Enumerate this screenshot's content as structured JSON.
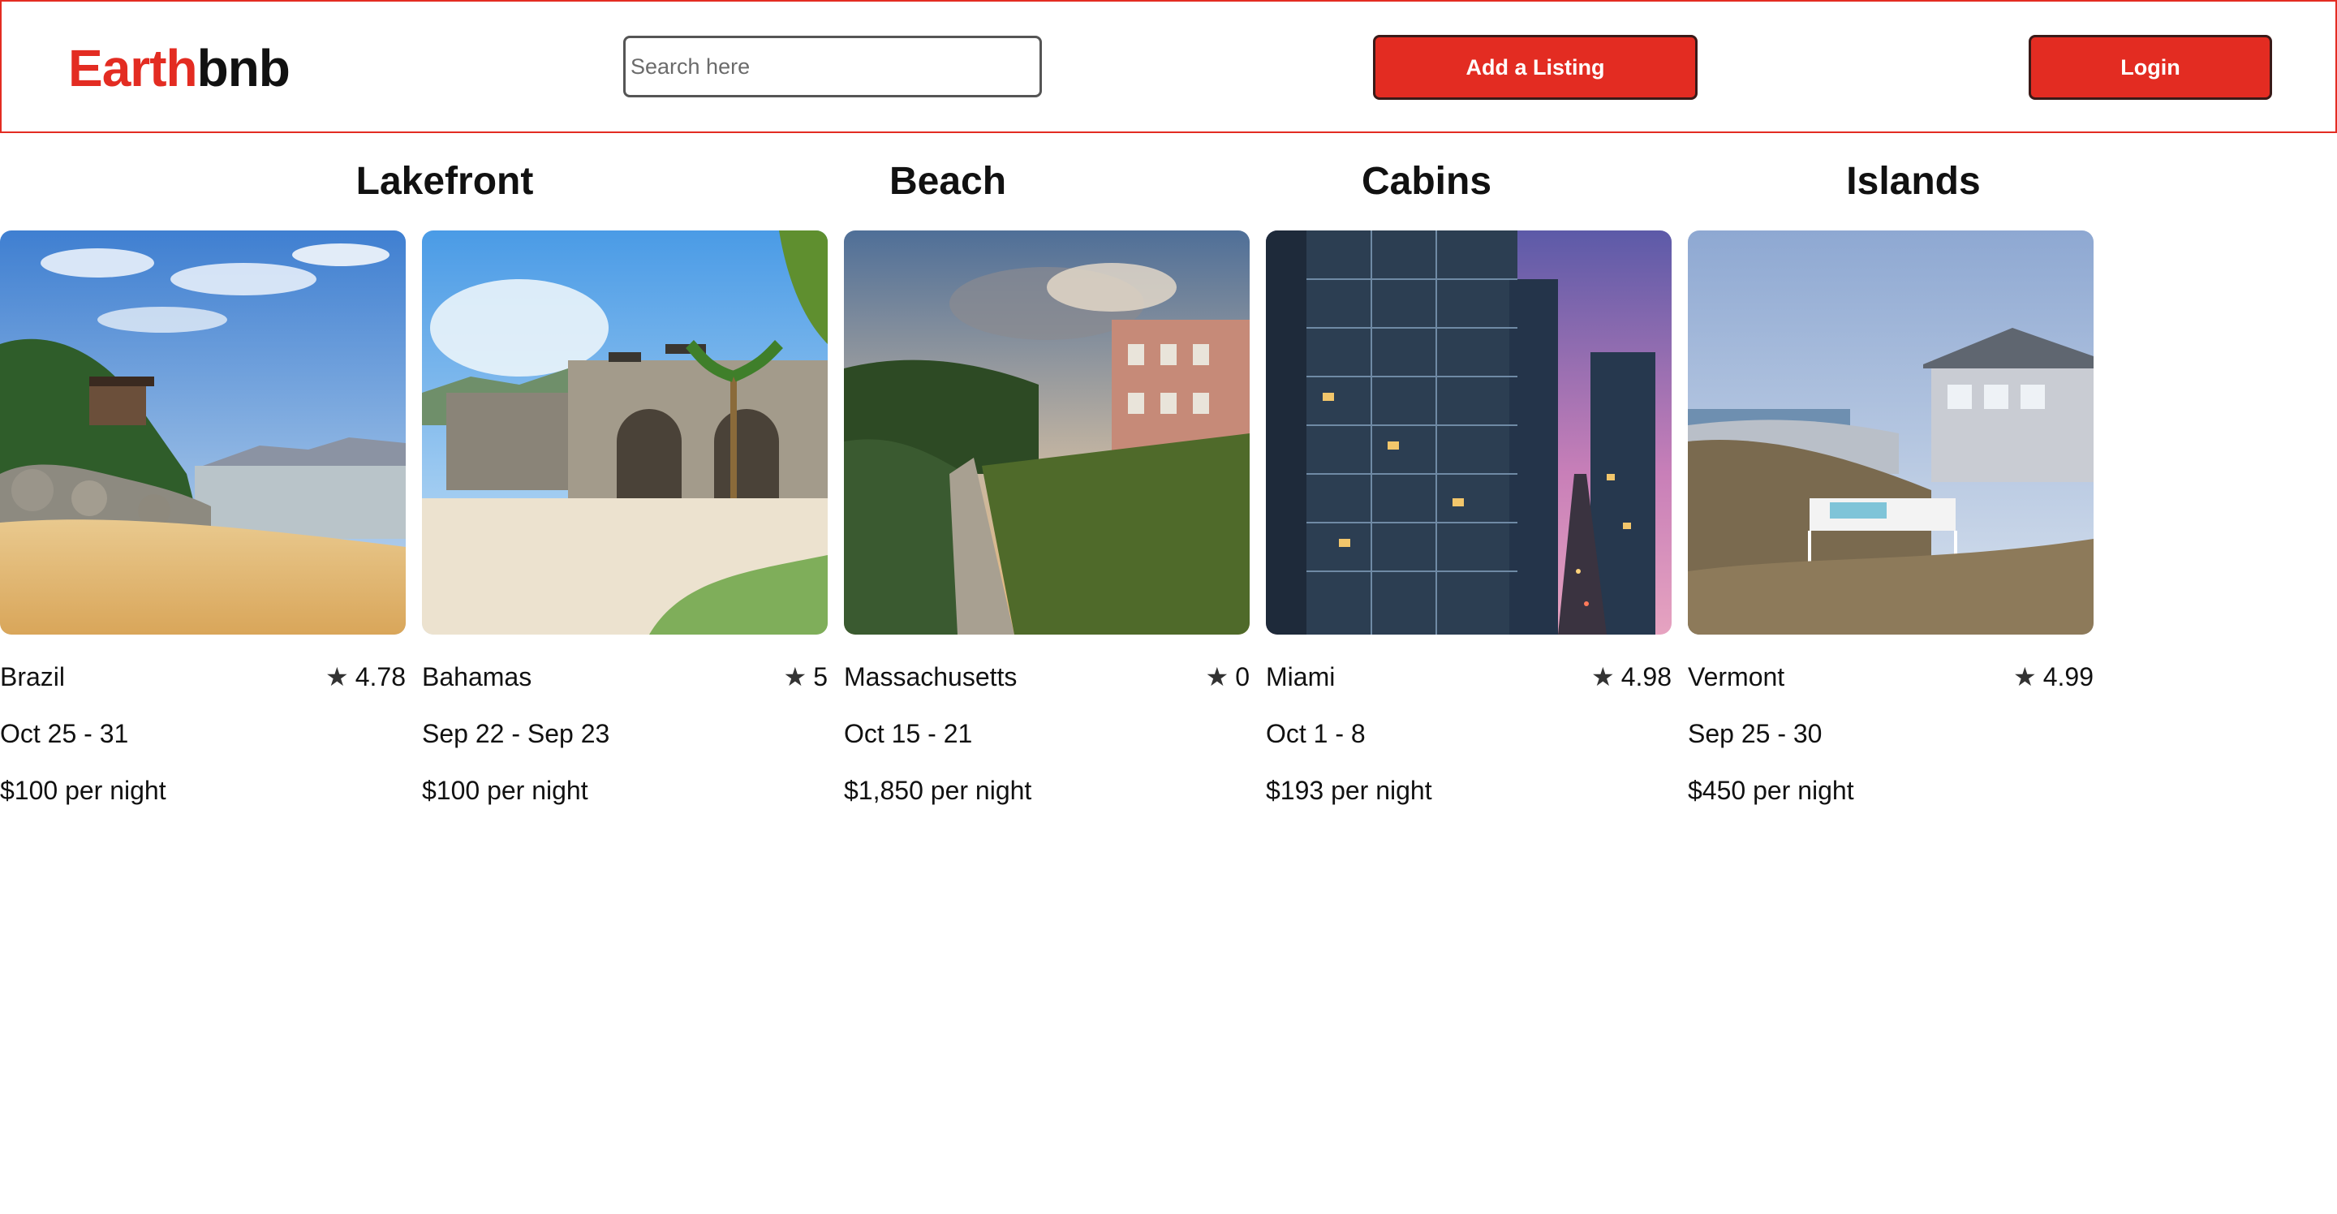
{
  "brand": {
    "part1": "Earth",
    "part2": "bnb",
    "accent_color": "#e32c22"
  },
  "search": {
    "placeholder": "Search here",
    "value": ""
  },
  "buttons": {
    "add_listing": "Add a Listing",
    "login": "Login"
  },
  "categories": [
    "Lakefront",
    "Beach",
    "Cabins",
    "Islands"
  ],
  "rating_icon": "star-icon",
  "listings": [
    {
      "location": "Brazil",
      "rating": "4.78",
      "dates": "Oct 25 - 31",
      "price": "$100 per night"
    },
    {
      "location": "Bahamas",
      "rating": "5",
      "dates": "Sep 22 - Sep 23",
      "price": "$100 per night"
    },
    {
      "location": "Massachusetts",
      "rating": "0",
      "dates": "Oct 15 - 21",
      "price": "$1,850 per night"
    },
    {
      "location": "Miami",
      "rating": "4.98",
      "dates": "Oct 1 - 8",
      "price": "$193 per night"
    },
    {
      "location": "Vermont",
      "rating": "4.99",
      "dates": "Sep 25 - 30",
      "price": "$450 per night"
    }
  ]
}
